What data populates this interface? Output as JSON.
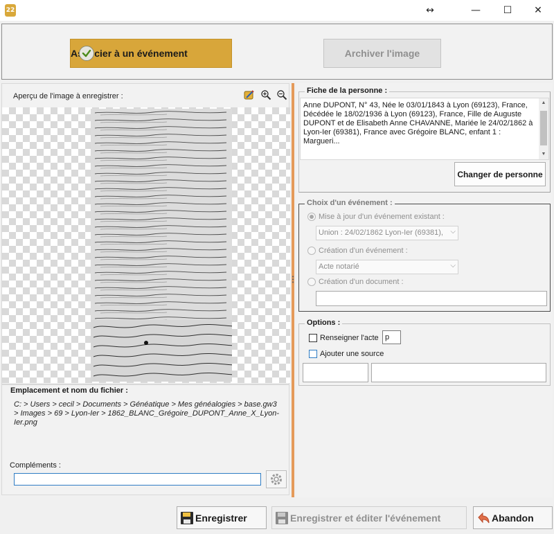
{
  "window": {
    "app_icon_text": "22",
    "resize_glyph": "↔",
    "minimize_glyph": "—",
    "maximize_glyph": "☐",
    "close_glyph": "✕"
  },
  "toolbar": {
    "associate_label": "Associer à un événement",
    "archive_label": "Archiver l'image"
  },
  "preview": {
    "label": "Aperçu de l'image à enregistrer :",
    "icons": [
      "edit-image-icon",
      "zoom-in-icon",
      "zoom-out-icon"
    ]
  },
  "location": {
    "title": "Emplacement et nom du fichier :",
    "path": "C: > Users > cecil > Documents > Généatique > Mes généalogies > base.gw3 > Images > 69 > Lyon-Ier > 1862_BLANC_Grégoire_DUPONT_Anne_X_Lyon-Ier.png",
    "complements_label": "Compléments :",
    "complements_value": ""
  },
  "person": {
    "title": "Fiche de la personne :",
    "text": "Anne DUPONT, N° 43, Née le 03/01/1843 à Lyon (69123), France, Décédée le 18/02/1936 à Lyon (69123), France, Fille de Auguste DUPONT et de Elisabeth Anne CHAVANNE, Mariée le 24/02/1862 à Lyon-Ier (69381), France avec Grégoire BLANC, enfant 1 : Margueri...",
    "change_button": "Changer de personne"
  },
  "event": {
    "title": "Choix d'un événement :",
    "option_update_label": "Mise à jour d'un événement existant :",
    "option_update_selected": true,
    "existing_select": "Union : 24/02/1862 Lyon-Ier (69381),",
    "option_create_label": "Création d'un événement :",
    "create_select": "Acte notarié",
    "option_document_label": "Création d'un document :",
    "document_value": ""
  },
  "options": {
    "title": "Options :",
    "fill_act_label": "Renseigner l'acte",
    "fill_act_value": "p",
    "add_source_label": "Ajouter une source",
    "field1": "",
    "field2": ""
  },
  "footer": {
    "save_label": "Enregistrer",
    "save_edit_label": "Enregistrer et éditer l'événement",
    "cancel_label": "Abandon"
  },
  "colors": {
    "accent_button": "#d8a63a",
    "splitter": "#e59a5a",
    "focus_border": "#2e7cc4"
  }
}
